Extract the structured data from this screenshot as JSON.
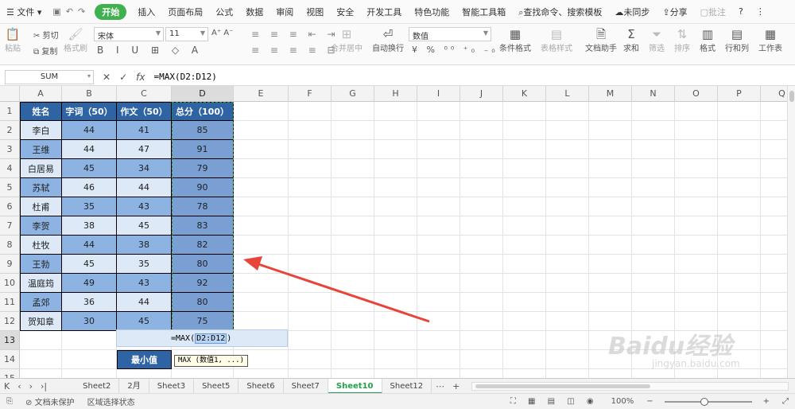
{
  "menubar": {
    "file_label": "文件",
    "items": [
      "开始",
      "插入",
      "页面布局",
      "公式",
      "数据",
      "审阅",
      "视图",
      "安全",
      "开发工具",
      "特色功能",
      "智能工具箱"
    ],
    "search_label": "查找命令、搜索模板",
    "sync_label": "未同步",
    "share_label": "分享",
    "comment_label": "批注"
  },
  "ribbon": {
    "paste": "粘贴",
    "cut": "剪切",
    "copy": "复制",
    "format_painter": "格式刷",
    "font_name": "宋体",
    "font_size": "11",
    "merge_center": "合并居中",
    "wrap_text": "自动换行",
    "number_format": "数值",
    "conditional_format": "条件格式",
    "table_style": "表格样式",
    "doc_helper": "文档助手",
    "sum": "求和",
    "filter": "筛选",
    "sort": "排序",
    "format": "格式",
    "row_col": "行和列",
    "worksheet": "工作表"
  },
  "formula_bar": {
    "name_box": "SUM",
    "fx": "fx",
    "formula": "=MAX(D2:D12)"
  },
  "columns": [
    "A",
    "B",
    "C",
    "D",
    "E",
    "F",
    "G",
    "H",
    "I",
    "J",
    "K",
    "L",
    "M",
    "N",
    "O",
    "P",
    "Q"
  ],
  "rows": [
    "1",
    "2",
    "3",
    "4",
    "5",
    "6",
    "7",
    "8",
    "9",
    "10",
    "11",
    "12",
    "13",
    "14",
    "15"
  ],
  "table": {
    "headers": [
      "姓名",
      "字词（50）",
      "作文（50）",
      "总分（100）"
    ],
    "data": [
      [
        "李白",
        "44",
        "41",
        "85"
      ],
      [
        "王维",
        "44",
        "47",
        "91"
      ],
      [
        "白居易",
        "45",
        "34",
        "79"
      ],
      [
        "苏轼",
        "46",
        "44",
        "90"
      ],
      [
        "杜甫",
        "35",
        "43",
        "78"
      ],
      [
        "李贺",
        "38",
        "45",
        "83"
      ],
      [
        "杜牧",
        "44",
        "38",
        "82"
      ],
      [
        "王勃",
        "45",
        "35",
        "80"
      ],
      [
        "温庭筠",
        "49",
        "43",
        "92"
      ],
      [
        "孟郊",
        "36",
        "44",
        "80"
      ],
      [
        "贺知章",
        "30",
        "45",
        "75"
      ]
    ],
    "min_label": "最小值"
  },
  "editing": {
    "prefix": "=MAX(",
    "ref": "D2:D12",
    "suffix": ")",
    "tooltip": "MAX (数值1, ...)"
  },
  "sheets": [
    "Sheet2",
    "2月",
    "Sheet3",
    "Sheet5",
    "Sheet6",
    "Sheet7",
    "Sheet10",
    "Sheet12"
  ],
  "active_sheet": "Sheet10",
  "status": {
    "protect": "文档未保护",
    "mode": "区域选择状态",
    "zoom": "100%",
    "zoom_level": 0.5
  },
  "watermark": {
    "brand": "Baidu经验",
    "url": "jingyan.baidu.com"
  },
  "colors": {
    "header": "#2f64a4",
    "light": "#dde9f7",
    "mid": "#8db3e2",
    "dark": "#7a9fd3",
    "accent": "#26a04a",
    "arrow": "#e8443a"
  }
}
